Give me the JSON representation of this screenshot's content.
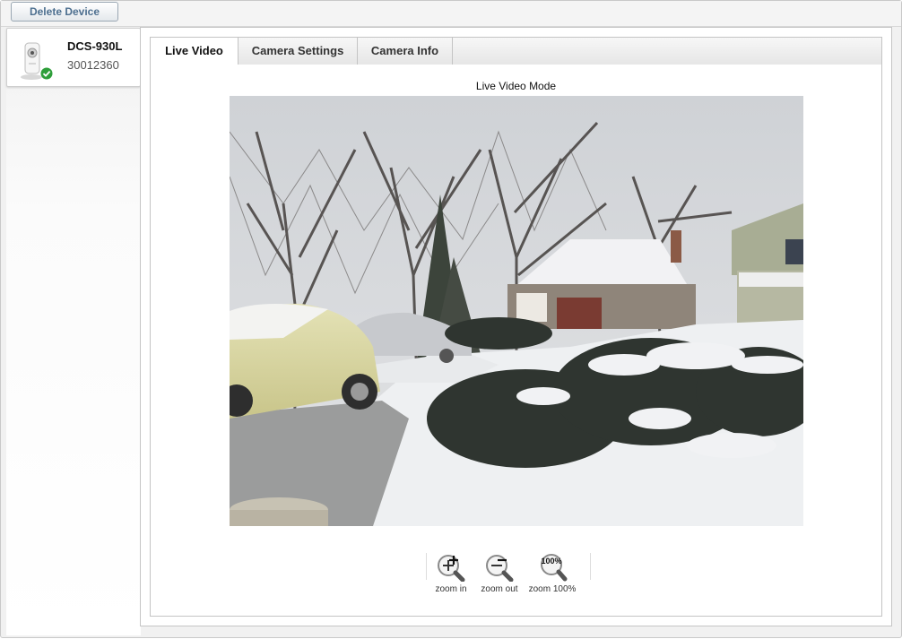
{
  "toolbar": {
    "delete_label": "Delete Device"
  },
  "device": {
    "name": "DCS-930L",
    "id": "30012360",
    "status_icon": "check-icon",
    "status_color": "#2e9e3a"
  },
  "tabs": [
    {
      "label": "Live Video",
      "active": true
    },
    {
      "label": "Camera Settings",
      "active": false
    },
    {
      "label": "Camera Info",
      "active": false
    }
  ],
  "live": {
    "mode_label": "Live Video Mode",
    "feed_description": "",
    "zoom": [
      {
        "label": "zoom in",
        "icon": "zoom-in-icon"
      },
      {
        "label": "zoom out",
        "icon": "zoom-out-icon"
      },
      {
        "label": "zoom 100%",
        "icon": "zoom-100-icon",
        "badge": "100%"
      }
    ]
  },
  "colors": {
    "accent": "#4d6f8f",
    "snow": "#eef0f2",
    "sky": "#d7d9dc"
  }
}
